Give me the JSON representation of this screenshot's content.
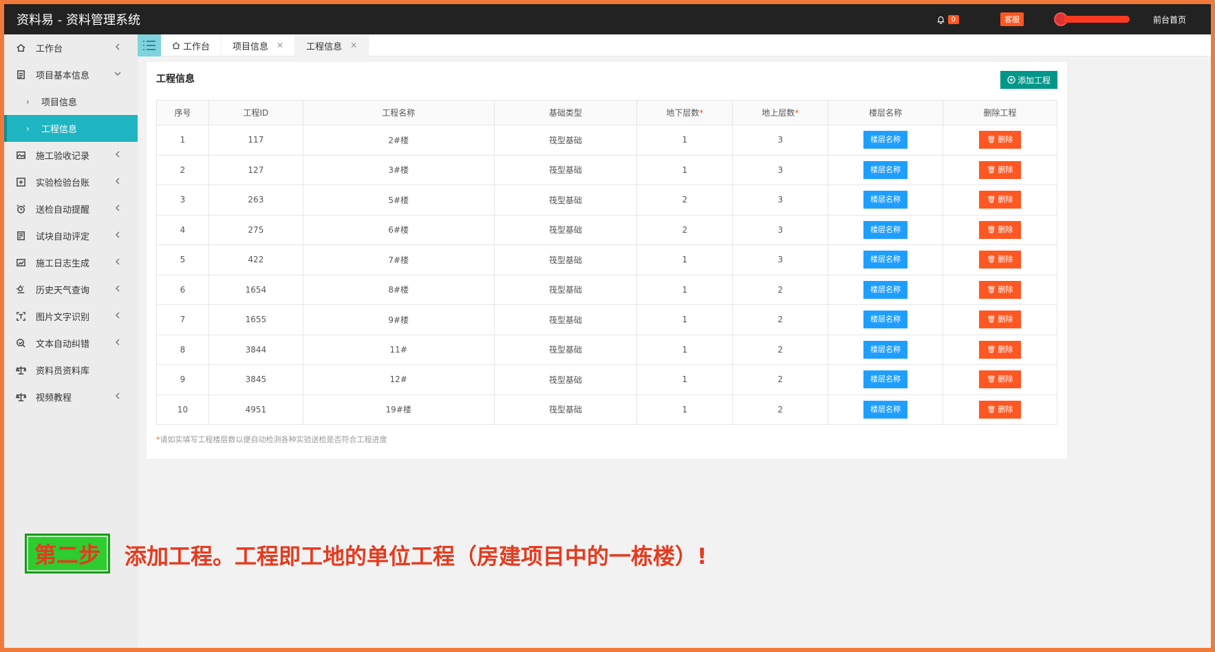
{
  "header": {
    "title": "资料易 - 资料管理系统",
    "notif_count": "0",
    "service_label": "客服",
    "front_link": "前台首页"
  },
  "sidebar": {
    "items": [
      {
        "label": "工作台",
        "icon": "home-icon",
        "chevron": "left"
      },
      {
        "label": "项目基本信息",
        "icon": "document-icon",
        "chevron": "down"
      },
      {
        "label": "施工验收记录",
        "icon": "image-icon",
        "chevron": "left"
      },
      {
        "label": "实验检验台账",
        "icon": "check-stamp-icon",
        "chevron": "left"
      },
      {
        "label": "送检自动提醒",
        "icon": "alarm-icon",
        "chevron": "left"
      },
      {
        "label": "试块自动评定",
        "icon": "form-icon",
        "chevron": "left"
      },
      {
        "label": "施工日志生成",
        "icon": "chart-image-icon",
        "chevron": "left"
      },
      {
        "label": "历史天气查询",
        "icon": "weather-icon",
        "chevron": "left"
      },
      {
        "label": "图片文字识别",
        "icon": "text-recognize-icon",
        "chevron": "left"
      },
      {
        "label": "文本自动纠错",
        "icon": "zoom-check-icon",
        "chevron": "left"
      },
      {
        "label": "资料员资料库",
        "icon": "scale-icon",
        "chevron": ""
      },
      {
        "label": "视频教程",
        "icon": "scale-icon",
        "chevron": "left"
      }
    ],
    "sub_items": [
      {
        "label": "项目信息",
        "active": false
      },
      {
        "label": "工程信息",
        "active": true
      }
    ]
  },
  "tabs": [
    {
      "label": "工作台",
      "closable": false
    },
    {
      "label": "项目信息",
      "closable": true
    },
    {
      "label": "工程信息",
      "closable": true
    }
  ],
  "panel": {
    "title": "工程信息",
    "add_button": "添加工程",
    "columns": [
      "序号",
      "工程ID",
      "工程名称",
      "基础类型",
      "地下层数",
      "地上层数",
      "楼层名称",
      "删除工程"
    ],
    "floor_button": "楼层名称",
    "delete_button": "删除",
    "rows": [
      [
        "1",
        "117",
        "2#楼",
        "筏型基础",
        "1",
        "3"
      ],
      [
        "2",
        "127",
        "3#楼",
        "筏型基础",
        "1",
        "3"
      ],
      [
        "3",
        "263",
        "5#楼",
        "筏型基础",
        "2",
        "3"
      ],
      [
        "4",
        "275",
        "6#楼",
        "筏型基础",
        "2",
        "3"
      ],
      [
        "5",
        "422",
        "7#楼",
        "筏型基础",
        "1",
        "3"
      ],
      [
        "6",
        "1654",
        "8#楼",
        "筏型基础",
        "1",
        "2"
      ],
      [
        "7",
        "1655",
        "9#楼",
        "筏型基础",
        "1",
        "2"
      ],
      [
        "8",
        "3844",
        "11#",
        "筏型基础",
        "1",
        "2"
      ],
      [
        "9",
        "3845",
        "12#",
        "筏型基础",
        "1",
        "2"
      ],
      [
        "10",
        "4951",
        "19#楼",
        "筏型基础",
        "1",
        "2"
      ]
    ],
    "note": "请如实填写工程楼层数以便自动检测各种实验送检是否符合工程进度"
  },
  "overlay": {
    "step": "第二步",
    "caption": "添加工程。工程即工地的单位工程（房建项目中的一栋楼）!"
  },
  "colors": {
    "accent": "#1fb5c2",
    "add_button": "#009688",
    "floor_button": "#1e9fff",
    "delete_button": "#ff5722"
  }
}
